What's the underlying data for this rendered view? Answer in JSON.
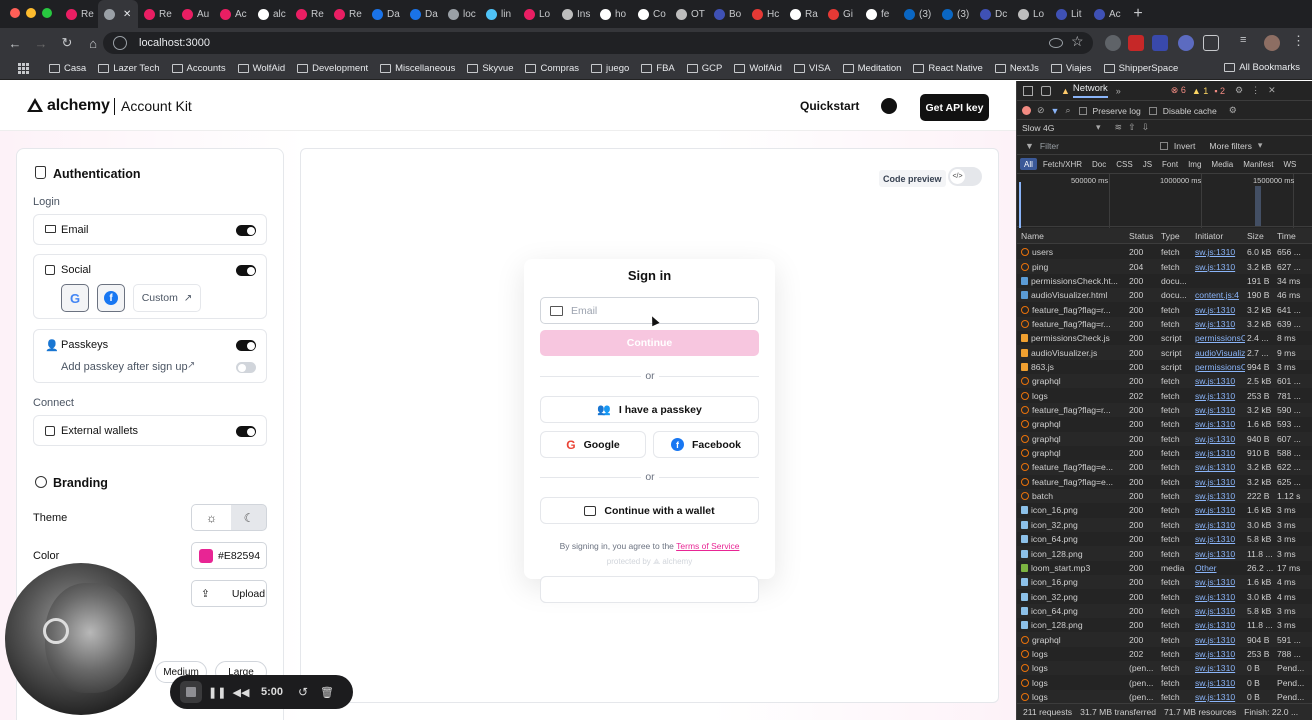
{
  "browser": {
    "tabs": [
      {
        "label": "Re",
        "color": "#e91e63"
      },
      {
        "label": "",
        "color": "#9aa0a6",
        "active": true
      },
      {
        "label": "Re",
        "color": "#e91e63"
      },
      {
        "label": "Au",
        "color": "#e91e63"
      },
      {
        "label": "Ac",
        "color": "#e91e63"
      },
      {
        "label": "alc",
        "color": "#ffffff"
      },
      {
        "label": "Re",
        "color": "#e91e63"
      },
      {
        "label": "Re",
        "color": "#e91e63"
      },
      {
        "label": "Da",
        "color": "#1a73e8"
      },
      {
        "label": "Da",
        "color": "#1a73e8"
      },
      {
        "label": "loc",
        "color": "#9aa0a6"
      },
      {
        "label": "lin",
        "color": "#4fc3f7"
      },
      {
        "label": "Lo",
        "color": "#e91e63"
      },
      {
        "label": "Ins",
        "color": "#bdbdbd"
      },
      {
        "label": "ho",
        "color": "#ffffff"
      },
      {
        "label": "Co",
        "color": "#ffffff"
      },
      {
        "label": "OT",
        "color": "#bdbdbd"
      },
      {
        "label": "Bo",
        "color": "#3f51b5"
      },
      {
        "label": "Hc",
        "color": "#e53935"
      },
      {
        "label": "Ra",
        "color": "#ffffff"
      },
      {
        "label": "Gi",
        "color": "#e53935"
      },
      {
        "label": "fe",
        "color": "#ffffff"
      },
      {
        "label": "(3)",
        "color": "#0a66c2"
      },
      {
        "label": "(3)",
        "color": "#0a66c2"
      },
      {
        "label": "Dc",
        "color": "#3f51b5"
      },
      {
        "label": "Lo",
        "color": "#bdbdbd"
      },
      {
        "label": "Lit",
        "color": "#3f51b5"
      },
      {
        "label": "Ac",
        "color": "#3f51b5"
      }
    ],
    "url": "localhost:3000",
    "bookmarks": [
      "Casa",
      "Lazer Tech",
      "Accounts",
      "WolfAid",
      "Development",
      "Miscellaneous",
      "Skyvue",
      "Compras",
      "juego",
      "FBA",
      "GCP",
      "WolfAid",
      "VISA",
      "Meditation",
      "React Native",
      "NextJs",
      "Viajes",
      "ShipperSpace"
    ],
    "all_bookmarks": "All Bookmarks"
  },
  "header": {
    "brand": "alchemy",
    "product": "Account Kit",
    "quickstart": "Quickstart",
    "cta": "Get API key"
  },
  "config": {
    "auth_title": "Authentication",
    "login_label": "Login",
    "email": "Email",
    "social": "Social",
    "custom": "Custom",
    "passkeys": "Passkeys",
    "add_passkey": "Add passkey after sign up",
    "connect_label": "Connect",
    "external_wallets": "External wallets",
    "branding_title": "Branding",
    "theme_label": "Theme",
    "color_label": "Color",
    "color_value": "#E82594",
    "upload": "Upload",
    "size_medium": "Medium",
    "size_large": "Large",
    "toggles": {
      "email": true,
      "social": true,
      "passkeys": true,
      "add_passkey": false,
      "external_wallets": true
    }
  },
  "preview": {
    "code_preview": "Code preview",
    "signin_title": "Sign in",
    "email_placeholder": "Email",
    "continue": "Continue",
    "or": "or",
    "passkey": "I have a passkey",
    "google": "Google",
    "facebook": "Facebook",
    "wallet": "Continue with a wallet",
    "terms_prefix": "By signing in, you agree to the",
    "terms_link": "Terms of Service",
    "protected": "protected by",
    "protected_brand": "alchemy",
    "accent": "#E82594"
  },
  "devtools": {
    "panel": "Network",
    "errors": "6",
    "warnings": "1",
    "issues": "2",
    "preserve_log": "Preserve log",
    "disable_cache": "Disable cache",
    "throttle": "Slow 4G",
    "filter": "Filter",
    "invert": "Invert",
    "more_filters": "More filters",
    "types": [
      "All",
      "Fetch/XHR",
      "Doc",
      "CSS",
      "JS",
      "Font",
      "Img",
      "Media",
      "Manifest",
      "WS"
    ],
    "timeline": [
      "500000 ms",
      "1000000 ms",
      "1500000 ms"
    ],
    "columns": [
      "Name",
      "Status",
      "Type",
      "Initiator",
      "Size",
      "Time"
    ],
    "rows": [
      [
        "users",
        "200",
        "fetch",
        "sw.js:1310",
        "6.0 kB",
        "656 ...",
        "fetch"
      ],
      [
        "ping",
        "204",
        "fetch",
        "sw.js:1310",
        "3.2 kB",
        "627 ...",
        "fetch"
      ],
      [
        "permissionsCheck.ht...",
        "200",
        "docu...",
        "",
        "191 B",
        "34 ms",
        "doc"
      ],
      [
        "audioVisualizer.html",
        "200",
        "docu...",
        "content.js:4",
        "190 B",
        "46 ms",
        "doc"
      ],
      [
        "feature_flag?flag=r...",
        "200",
        "fetch",
        "sw.js:1310",
        "3.2 kB",
        "641 ...",
        "fetch"
      ],
      [
        "feature_flag?flag=r...",
        "200",
        "fetch",
        "sw.js:1310",
        "3.2 kB",
        "639 ...",
        "fetch"
      ],
      [
        "permissionsCheck.js",
        "200",
        "script",
        "permissionsC",
        "2.4 ...",
        "8 ms",
        "script"
      ],
      [
        "audioVisualizer.js",
        "200",
        "script",
        "audioVisualiz",
        "2.7 ...",
        "9 ms",
        "script"
      ],
      [
        "863.js",
        "200",
        "script",
        "permissionsC",
        "994 B",
        "3 ms",
        "script"
      ],
      [
        "graphql",
        "200",
        "fetch",
        "sw.js:1310",
        "2.5 kB",
        "601 ...",
        "fetch"
      ],
      [
        "logs",
        "202",
        "fetch",
        "sw.js:1310",
        "253 B",
        "781 ...",
        "fetch"
      ],
      [
        "feature_flag?flag=r...",
        "200",
        "fetch",
        "sw.js:1310",
        "3.2 kB",
        "590 ...",
        "fetch"
      ],
      [
        "graphql",
        "200",
        "fetch",
        "sw.js:1310",
        "1.6 kB",
        "593 ...",
        "fetch"
      ],
      [
        "graphql",
        "200",
        "fetch",
        "sw.js:1310",
        "940 B",
        "607 ...",
        "fetch"
      ],
      [
        "graphql",
        "200",
        "fetch",
        "sw.js:1310",
        "910 B",
        "588 ...",
        "fetch"
      ],
      [
        "feature_flag?flag=e...",
        "200",
        "fetch",
        "sw.js:1310",
        "3.2 kB",
        "622 ...",
        "fetch"
      ],
      [
        "feature_flag?flag=e...",
        "200",
        "fetch",
        "sw.js:1310",
        "3.2 kB",
        "625 ...",
        "fetch"
      ],
      [
        "batch",
        "200",
        "fetch",
        "sw.js:1310",
        "222 B",
        "1.12 s",
        "fetch"
      ],
      [
        "icon_16.png",
        "200",
        "fetch",
        "sw.js:1310",
        "1.6 kB",
        "3 ms",
        "img"
      ],
      [
        "icon_32.png",
        "200",
        "fetch",
        "sw.js:1310",
        "3.0 kB",
        "3 ms",
        "img"
      ],
      [
        "icon_64.png",
        "200",
        "fetch",
        "sw.js:1310",
        "5.8 kB",
        "3 ms",
        "img"
      ],
      [
        "icon_128.png",
        "200",
        "fetch",
        "sw.js:1310",
        "11.8 ...",
        "3 ms",
        "img"
      ],
      [
        "loom_start.mp3",
        "200",
        "media",
        "Other",
        "26.2 ...",
        "17 ms",
        "media"
      ],
      [
        "icon_16.png",
        "200",
        "fetch",
        "sw.js:1310",
        "1.6 kB",
        "4 ms",
        "img"
      ],
      [
        "icon_32.png",
        "200",
        "fetch",
        "sw.js:1310",
        "3.0 kB",
        "4 ms",
        "img"
      ],
      [
        "icon_64.png",
        "200",
        "fetch",
        "sw.js:1310",
        "5.8 kB",
        "3 ms",
        "img"
      ],
      [
        "icon_128.png",
        "200",
        "fetch",
        "sw.js:1310",
        "11.8 ...",
        "3 ms",
        "img"
      ],
      [
        "graphql",
        "200",
        "fetch",
        "sw.js:1310",
        "904 B",
        "591 ...",
        "fetch"
      ],
      [
        "logs",
        "202",
        "fetch",
        "sw.js:1310",
        "253 B",
        "788 ...",
        "fetch"
      ],
      [
        "logs",
        "(pen...",
        "fetch",
        "sw.js:1310",
        "0 B",
        "Pend...",
        "fetch"
      ],
      [
        "logs",
        "(pen...",
        "fetch",
        "sw.js:1310",
        "0 B",
        "Pend...",
        "fetch"
      ],
      [
        "logs",
        "(pen...",
        "fetch",
        "sw.js:1310",
        "0 B",
        "Pend...",
        "fetch"
      ],
      [
        "logs",
        "(pen...",
        "fetch",
        "sw.js:1310",
        "0 B",
        "Pend...",
        "fetch"
      ]
    ],
    "summary": [
      "211 requests",
      "31.7 MB transferred",
      "71.7 MB resources",
      "Finish: 22.0 ..."
    ]
  },
  "recorder": {
    "time": "5:00"
  }
}
